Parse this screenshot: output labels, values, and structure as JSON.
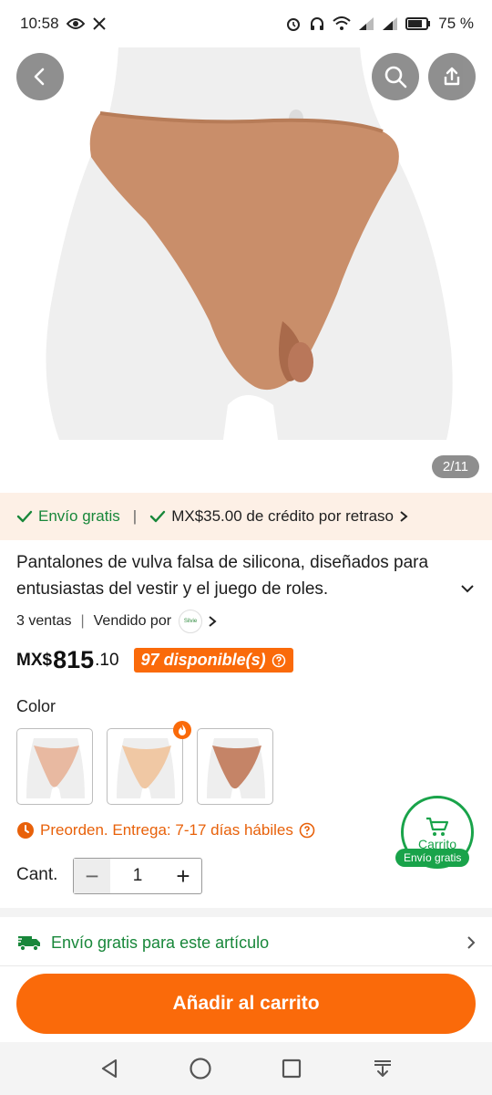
{
  "status_bar": {
    "time": "10:58",
    "battery": "75 %"
  },
  "gallery": {
    "counter": "2/11"
  },
  "shipping_banner": {
    "free_shipping": "Envío gratis",
    "separator": "|",
    "credit": "MX$35.00 de crédito por retraso"
  },
  "product": {
    "title": "Pantalones de vulva falsa de silicona, diseñados para entusiastas del vestir y el juego de roles.",
    "sales": "3 ventas",
    "meta_separator": "|",
    "sold_by": "Vendido por",
    "seller_logo_text": "Silvie",
    "price_currency": "MX$",
    "price_main": "815",
    "price_cents": ".10",
    "stock": "97 disponible(s)"
  },
  "color_section": {
    "label": "Color"
  },
  "delivery": {
    "preorder": "Preorden. Entrega: 7-17 días hábiles"
  },
  "quantity": {
    "label": "Cant.",
    "minus": "−",
    "value": "1",
    "plus": "+"
  },
  "cart_fab": {
    "label": "Carrito",
    "pill": "Envío gratis"
  },
  "free_ship_row": {
    "label": "Envío gratis para este artículo"
  },
  "actions": {
    "add_to_cart": "Añadir al carrito"
  },
  "colors": {
    "accent_orange": "#fa6a0a",
    "green": "#18873a",
    "banner_bg": "#fdf0e6"
  }
}
